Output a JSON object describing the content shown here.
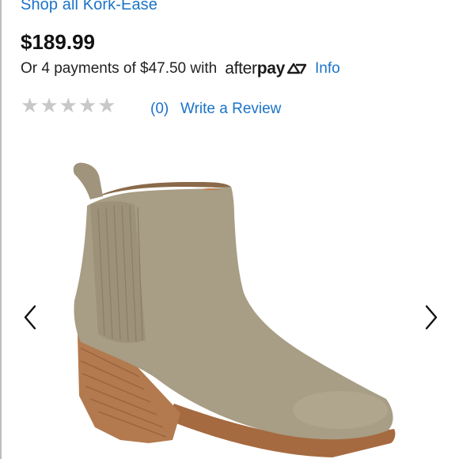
{
  "header": {
    "shop_link": "Shop all Kork-Ease"
  },
  "product": {
    "price": "$189.99",
    "payments_text": "Or 4 payments of $47.50 with",
    "afterpay_logo": {
      "after": "after",
      "pay": "pay"
    },
    "info_link": "Info",
    "rating": {
      "stars_filled": 0,
      "stars_total": 5,
      "count": "(0)",
      "write_review": "Write a Review"
    }
  },
  "gallery": {
    "prev_icon": "chevron-left-icon",
    "next_icon": "chevron-right-icon"
  },
  "colors": {
    "link": "#1a73c8",
    "price": "#111111",
    "star_empty": "#c8c8c8",
    "suede": "#a89d85",
    "heel_wood": "#b27a4e"
  }
}
